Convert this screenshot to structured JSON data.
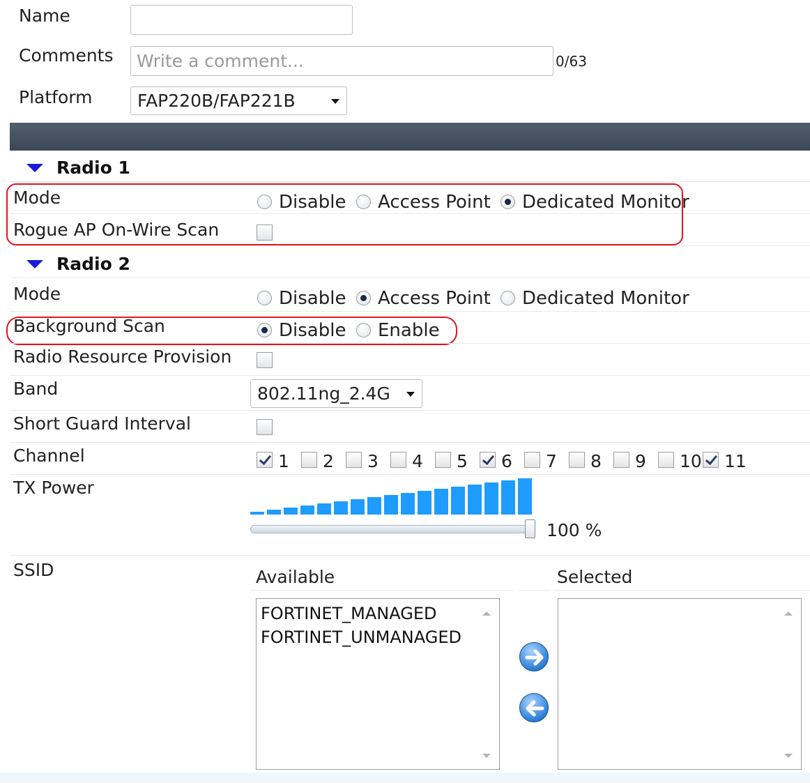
{
  "form": {
    "name": {
      "label": "Name",
      "value": ""
    },
    "comments": {
      "label": "Comments",
      "placeholder": "Write a comment...",
      "counter": "0/63"
    },
    "platform": {
      "label": "Platform",
      "value": "FAP220B/FAP221B"
    }
  },
  "radio1": {
    "title": "Radio 1",
    "mode": {
      "label": "Mode",
      "options": [
        "Disable",
        "Access Point",
        "Dedicated Monitor"
      ],
      "selected": "Dedicated Monitor"
    },
    "rogue_scan": {
      "label": "Rogue AP On-Wire Scan",
      "checked": false
    }
  },
  "radio2": {
    "title": "Radio 2",
    "mode": {
      "label": "Mode",
      "options": [
        "Disable",
        "Access Point",
        "Dedicated Monitor"
      ],
      "selected": "Access Point"
    },
    "background_scan": {
      "label": "Background Scan",
      "options": [
        "Disable",
        "Enable"
      ],
      "selected": "Disable"
    },
    "rrp": {
      "label": "Radio Resource Provision",
      "checked": false
    },
    "band": {
      "label": "Band",
      "value": "802.11ng_2.4G"
    },
    "sgi": {
      "label": "Short Guard Interval",
      "checked": false
    },
    "channel": {
      "label": "Channel",
      "channels": [
        {
          "n": "1",
          "checked": true
        },
        {
          "n": "2",
          "checked": false
        },
        {
          "n": "3",
          "checked": false
        },
        {
          "n": "4",
          "checked": false
        },
        {
          "n": "5",
          "checked": false
        },
        {
          "n": "6",
          "checked": true
        },
        {
          "n": "7",
          "checked": false
        },
        {
          "n": "8",
          "checked": false
        },
        {
          "n": "9",
          "checked": false
        },
        {
          "n": "10",
          "checked": false
        },
        {
          "n": "11",
          "checked": true
        }
      ]
    },
    "tx_power": {
      "label": "TX Power",
      "value": 100,
      "display": "100 %"
    },
    "ssid": {
      "label": "SSID",
      "available_label": "Available",
      "selected_label": "Selected",
      "available": [
        "FORTINET_MANAGED",
        "FORTINET_UNMANAGED"
      ],
      "selected": []
    }
  },
  "colors": {
    "accent_bar": "#1e9cff",
    "highlight": "#e0141e",
    "header": "#46525f"
  },
  "icons": {
    "move_right": "arrow-right-circle-icon",
    "move_left": "arrow-left-circle-icon"
  }
}
